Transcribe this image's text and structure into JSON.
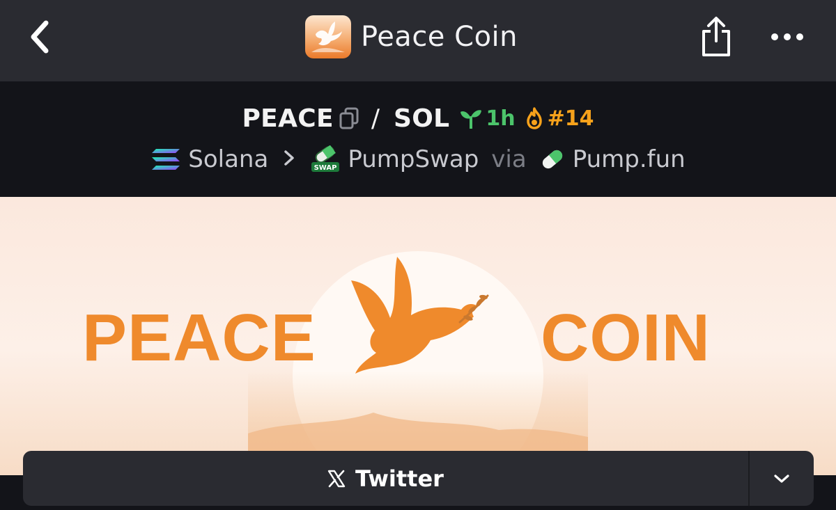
{
  "header": {
    "title": "Peace Coin",
    "back_icon": "chevron-left-icon",
    "share_icon": "share-icon",
    "more_icon": "more-horizontal-icon"
  },
  "pair": {
    "base": "PEACE",
    "separator": "/",
    "quote": "SOL",
    "age": "1h",
    "rank": "#14",
    "age_color": "#4cc46b",
    "rank_color": "#f7a21b"
  },
  "route": {
    "chain": "Solana",
    "dex": "PumpSwap",
    "via_label": "via",
    "launchpad": "Pump.fun",
    "dex_badge": "SWAP"
  },
  "banner": {
    "word_left": "PEACE",
    "word_right": "COIN",
    "accent": "#ef8a2c"
  },
  "links": {
    "primary_label": "Twitter",
    "primary_icon": "x-logo-icon",
    "toggle_icon": "chevron-down-icon"
  }
}
